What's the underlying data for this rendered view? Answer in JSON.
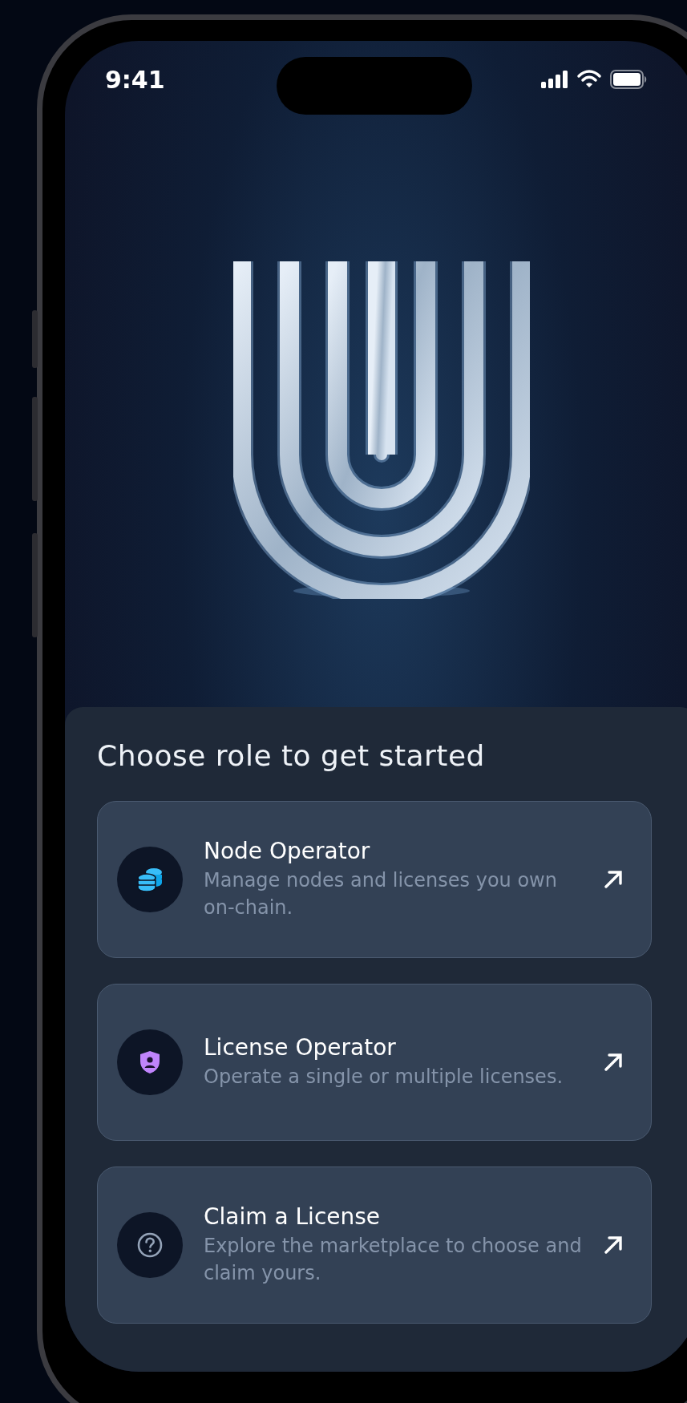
{
  "status_bar": {
    "time": "9:41"
  },
  "sheet": {
    "title": "Choose role to get started",
    "roles": [
      {
        "title": "Node Operator",
        "description": "Manage nodes and licenses you own on-chain."
      },
      {
        "title": "License Operator",
        "description": "Operate a single or multiple licenses."
      },
      {
        "title": "Claim a License",
        "description": "Explore the marketplace to choose and claim yours."
      }
    ]
  }
}
